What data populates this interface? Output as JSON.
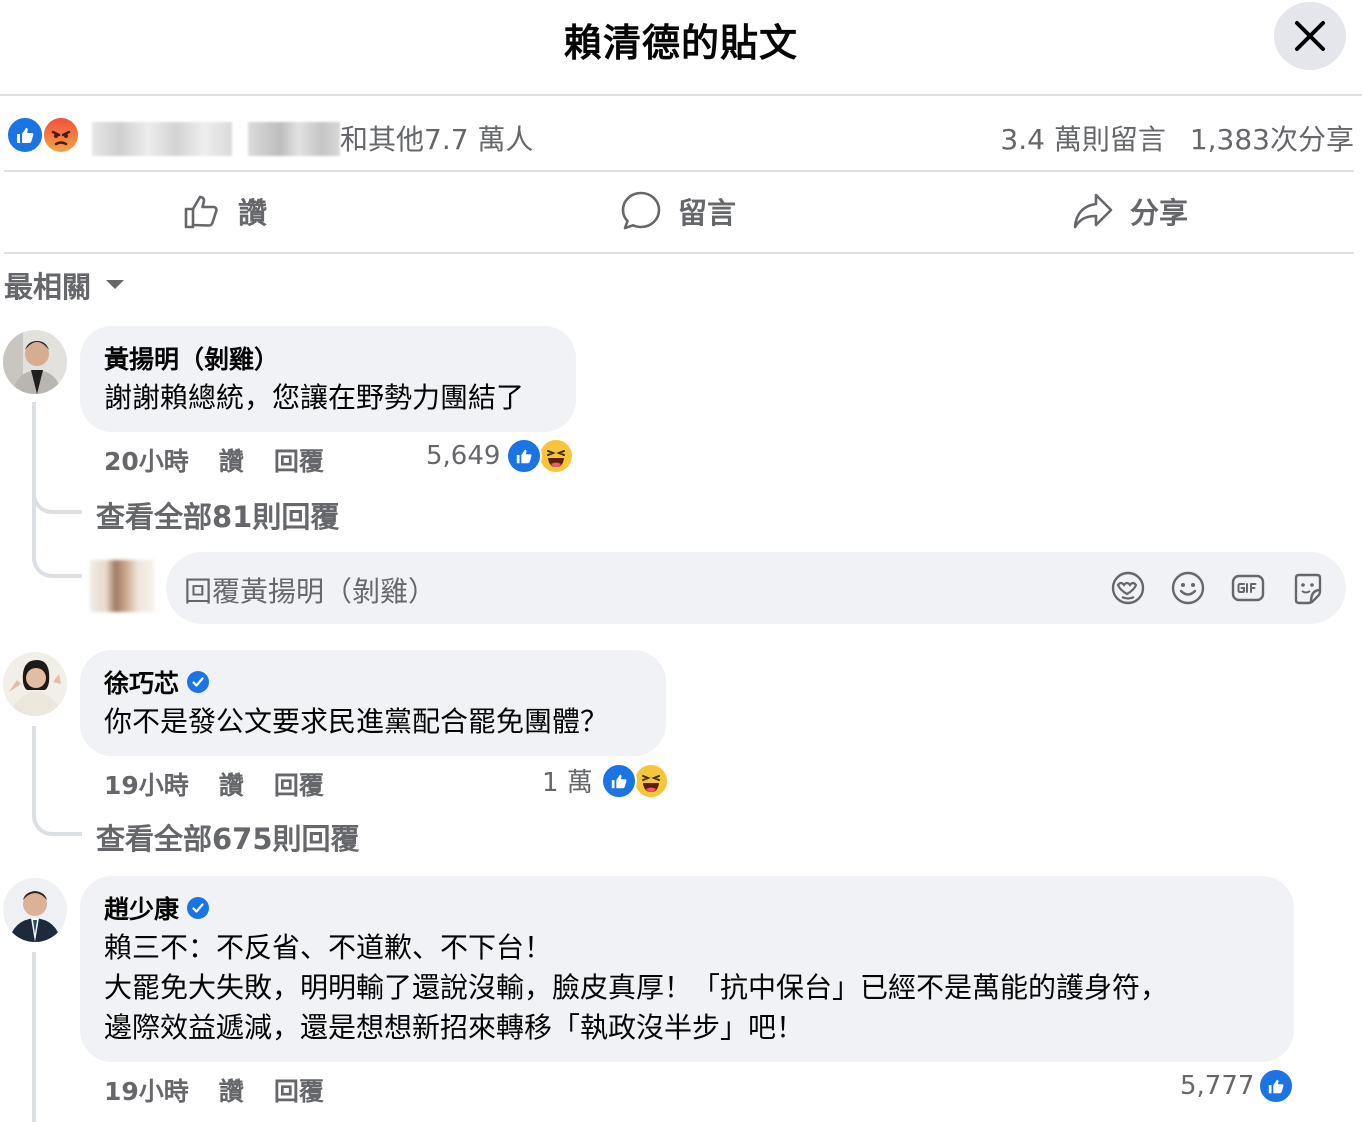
{
  "header": {
    "title": "賴清德的貼文"
  },
  "stats": {
    "others_text": "和其他7.7 萬人",
    "comments_count": "3.4 萬則留言",
    "shares_count": "1,383次分享"
  },
  "actions": {
    "like": "讚",
    "comment": "留言",
    "share": "分享"
  },
  "sort": {
    "label": "最相關"
  },
  "comments": [
    {
      "author": "黃揚明（剝雞）",
      "text": "謝謝賴總統，您讓在野勢力團結了",
      "time": "20小時",
      "like_label": "讚",
      "reply_label": "回覆",
      "reaction_count": "5,649",
      "view_replies": "查看全部81則回覆",
      "reply_placeholder": "回覆黃揚明（剝雞）"
    },
    {
      "author": "徐巧芯",
      "text": "你不是發公文要求民進黨配合罷免團體？",
      "time": "19小時",
      "like_label": "讚",
      "reply_label": "回覆",
      "reaction_count": "1 萬",
      "view_replies": "查看全部675則回覆"
    },
    {
      "author": "趙少康",
      "text": "賴三不：不反省、不道歉、不下台！\n大罷免大失敗，明明輸了還說沒輸，臉皮真厚！「抗中保台」已經不是萬能的護身符，\n邊際效益遞減，還是想想新招來轉移「執政沒半步」吧！",
      "time": "19小時",
      "like_label": "讚",
      "reply_label": "回覆",
      "reaction_count": "5,777"
    }
  ],
  "colors": {
    "like_blue": "#1b74e4",
    "secondary_text": "#65676b",
    "bubble_bg": "#f0f2f5"
  }
}
